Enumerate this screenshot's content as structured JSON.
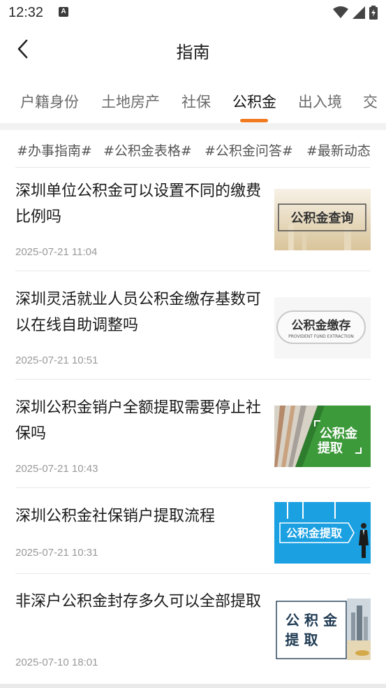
{
  "status_bar": {
    "time": "12:32",
    "app_badge": "A"
  },
  "header": {
    "title": "指南"
  },
  "tabs": [
    {
      "label": "户籍身份"
    },
    {
      "label": "土地房产"
    },
    {
      "label": "社保"
    },
    {
      "label": "公积金",
      "active": true
    },
    {
      "label": "出入境"
    },
    {
      "label": "交"
    }
  ],
  "hashtags": [
    "#办事指南#",
    "#公积金表格#",
    "#公积金问答#",
    "#最新动态#"
  ],
  "articles": [
    {
      "title": "深圳单位公积金可以设置不同的缴费比例吗",
      "date": "2025-07-21 11:04",
      "thumb_text": "公积金查询"
    },
    {
      "title": "深圳灵活就业人员公积金缴存基数可以在线自助调整吗",
      "date": "2025-07-21 10:51",
      "thumb_text": "公积金缴存",
      "thumb_subtext": "PROVIDENT FUND EXTRACTION"
    },
    {
      "title": "深圳公积金销户全额提取需要停止社保吗",
      "date": "2025-07-21 10:43",
      "thumb_text_1": "公积金",
      "thumb_text_2": "提取"
    },
    {
      "title": "深圳公积金社保销户提取流程",
      "date": "2025-07-21 10:31",
      "thumb_text": "公积金提取"
    },
    {
      "title": "非深户公积金封存多久可以全部提取",
      "date": "2025-07-10 18:01",
      "thumb_text_1": "公 积 金",
      "thumb_text_2": "提 取"
    }
  ],
  "colors": {
    "accent": "#f07a1f",
    "thumb_blue": "#1ba0e2",
    "thumb_green": "#3d9a3a"
  }
}
